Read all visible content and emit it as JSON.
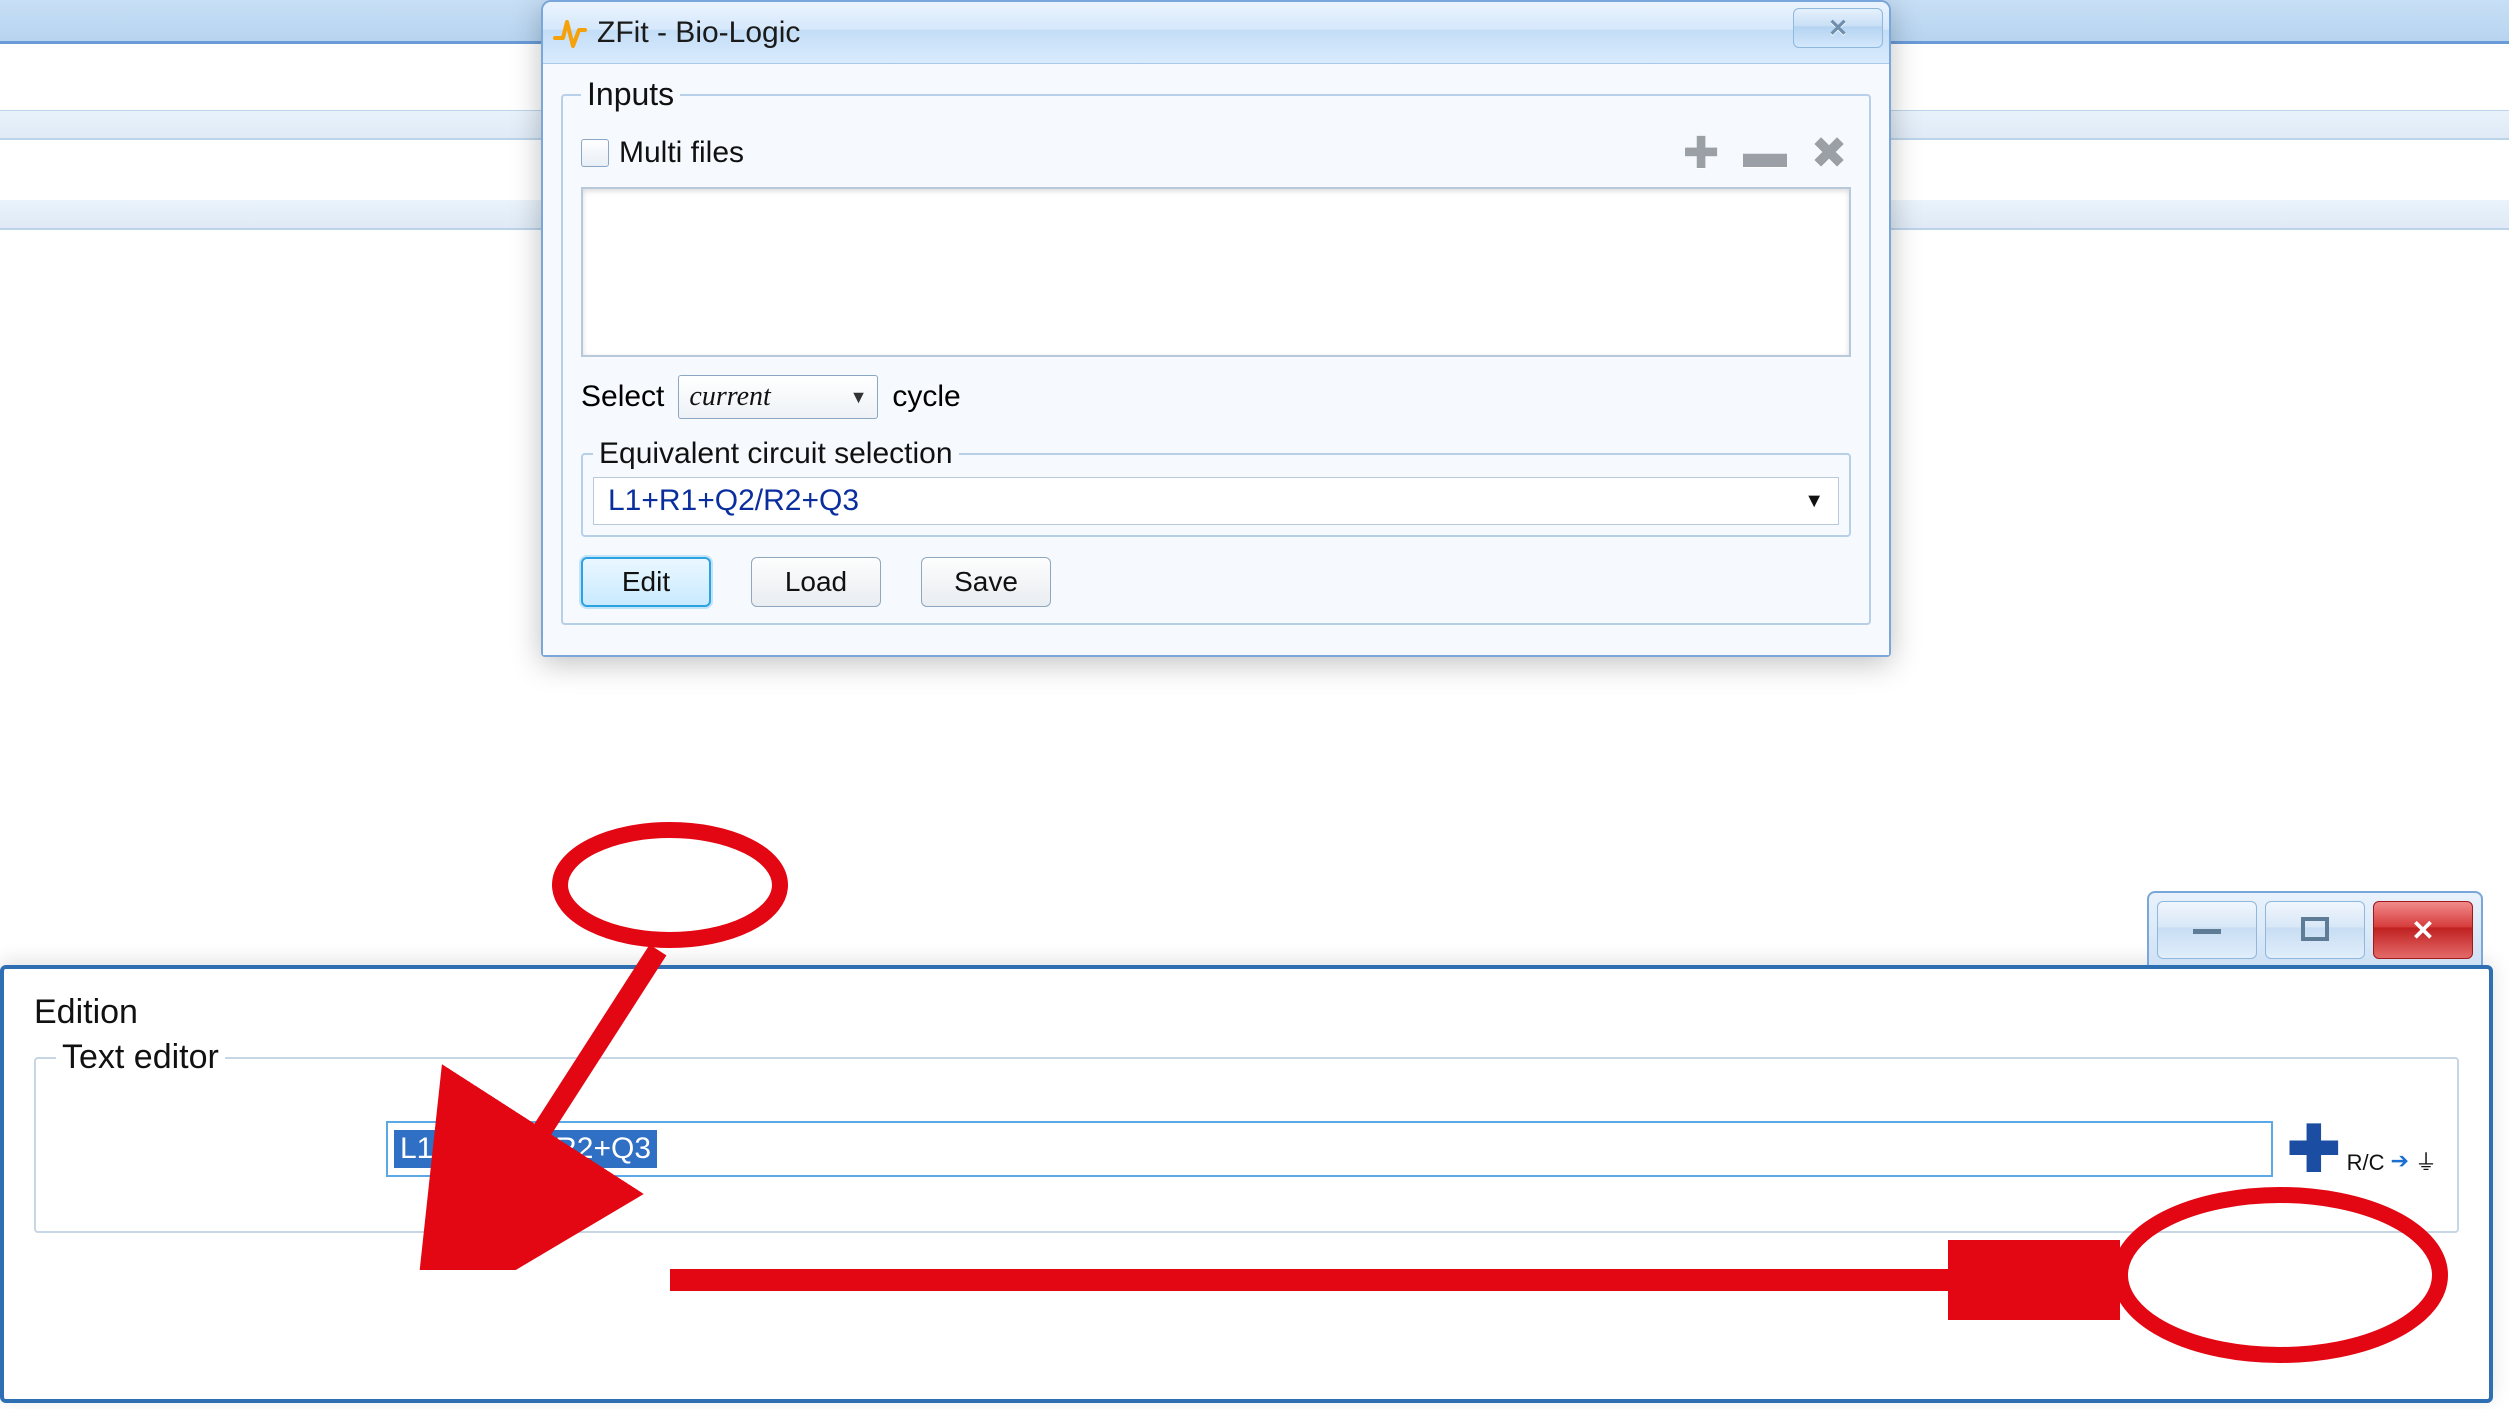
{
  "zfit": {
    "title": "ZFit - Bio-Logic",
    "inputs_legend": "Inputs",
    "multi_files_label": "Multi files",
    "select_label": "Select",
    "select_value": "current",
    "cycle_label": "cycle",
    "eq_legend": "Equivalent circuit selection",
    "circuit_value": "L1+R1+Q2/R2+Q3",
    "edit_label": "Edit",
    "load_label": "Load",
    "save_label": "Save"
  },
  "editor": {
    "edition_label": "Edition",
    "text_editor_legend": "Text editor",
    "text_value": "L1+R1+Q2/R2+Q3",
    "rc_label": "R/C"
  }
}
